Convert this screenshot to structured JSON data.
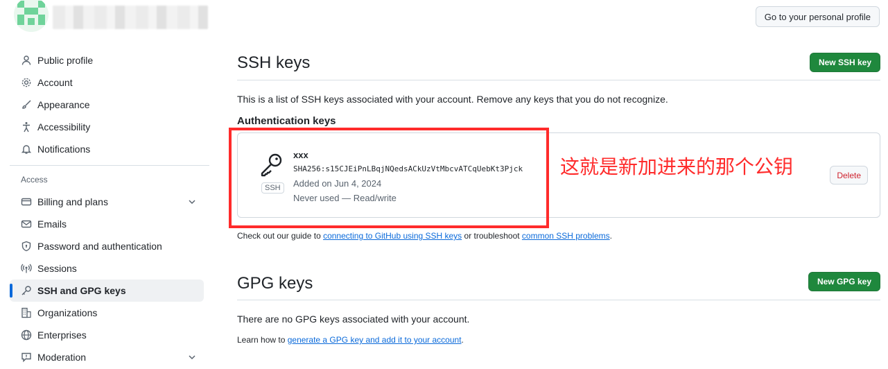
{
  "header": {
    "profile_button": "Go to your personal profile"
  },
  "sidebar": {
    "items": [
      {
        "label": "Public profile",
        "icon": "person-icon"
      },
      {
        "label": "Account",
        "icon": "gear-icon"
      },
      {
        "label": "Appearance",
        "icon": "paintbrush-icon"
      },
      {
        "label": "Accessibility",
        "icon": "accessibility-icon"
      },
      {
        "label": "Notifications",
        "icon": "bell-icon"
      }
    ],
    "access_heading": "Access",
    "access_items": [
      {
        "label": "Billing and plans",
        "icon": "credit-card-icon",
        "expandable": true
      },
      {
        "label": "Emails",
        "icon": "mail-icon"
      },
      {
        "label": "Password and authentication",
        "icon": "shield-lock-icon"
      },
      {
        "label": "Sessions",
        "icon": "broadcast-icon"
      },
      {
        "label": "SSH and GPG keys",
        "icon": "key-icon",
        "active": true
      },
      {
        "label": "Organizations",
        "icon": "organization-icon"
      },
      {
        "label": "Enterprises",
        "icon": "globe-icon"
      },
      {
        "label": "Moderation",
        "icon": "report-icon",
        "expandable": true
      }
    ]
  },
  "ssh": {
    "title": "SSH keys",
    "new_button": "New SSH key",
    "description": "This is a list of SSH keys associated with your account. Remove any keys that you do not recognize.",
    "auth_heading": "Authentication keys",
    "key": {
      "badge": "SSH",
      "title": "xxx",
      "fingerprint": "SHA256:s15CJEiPnLBqjNQedsACkUzVtMbcvATCqUebKt3Pjck",
      "added": "Added on Jun 4, 2024",
      "usage": "Never used — Read/write",
      "delete_button": "Delete"
    },
    "guide_prefix": "Check out our guide to ",
    "guide_link1": "connecting to GitHub using SSH keys",
    "guide_middle": " or troubleshoot ",
    "guide_link2": "common SSH problems",
    "guide_suffix": "."
  },
  "gpg": {
    "title": "GPG keys",
    "new_button": "New GPG key",
    "empty": "There are no GPG keys associated with your account.",
    "learn_prefix": "Learn how to ",
    "learn_link": "generate a GPG key and add it to your account",
    "learn_suffix": "."
  },
  "annotation": {
    "note": "这就是新加进来的那个公钥",
    "color": "#ff2b2b"
  },
  "colors": {
    "accent": "#0969da",
    "primary_button": "#1f883d",
    "danger": "#cf222e"
  }
}
